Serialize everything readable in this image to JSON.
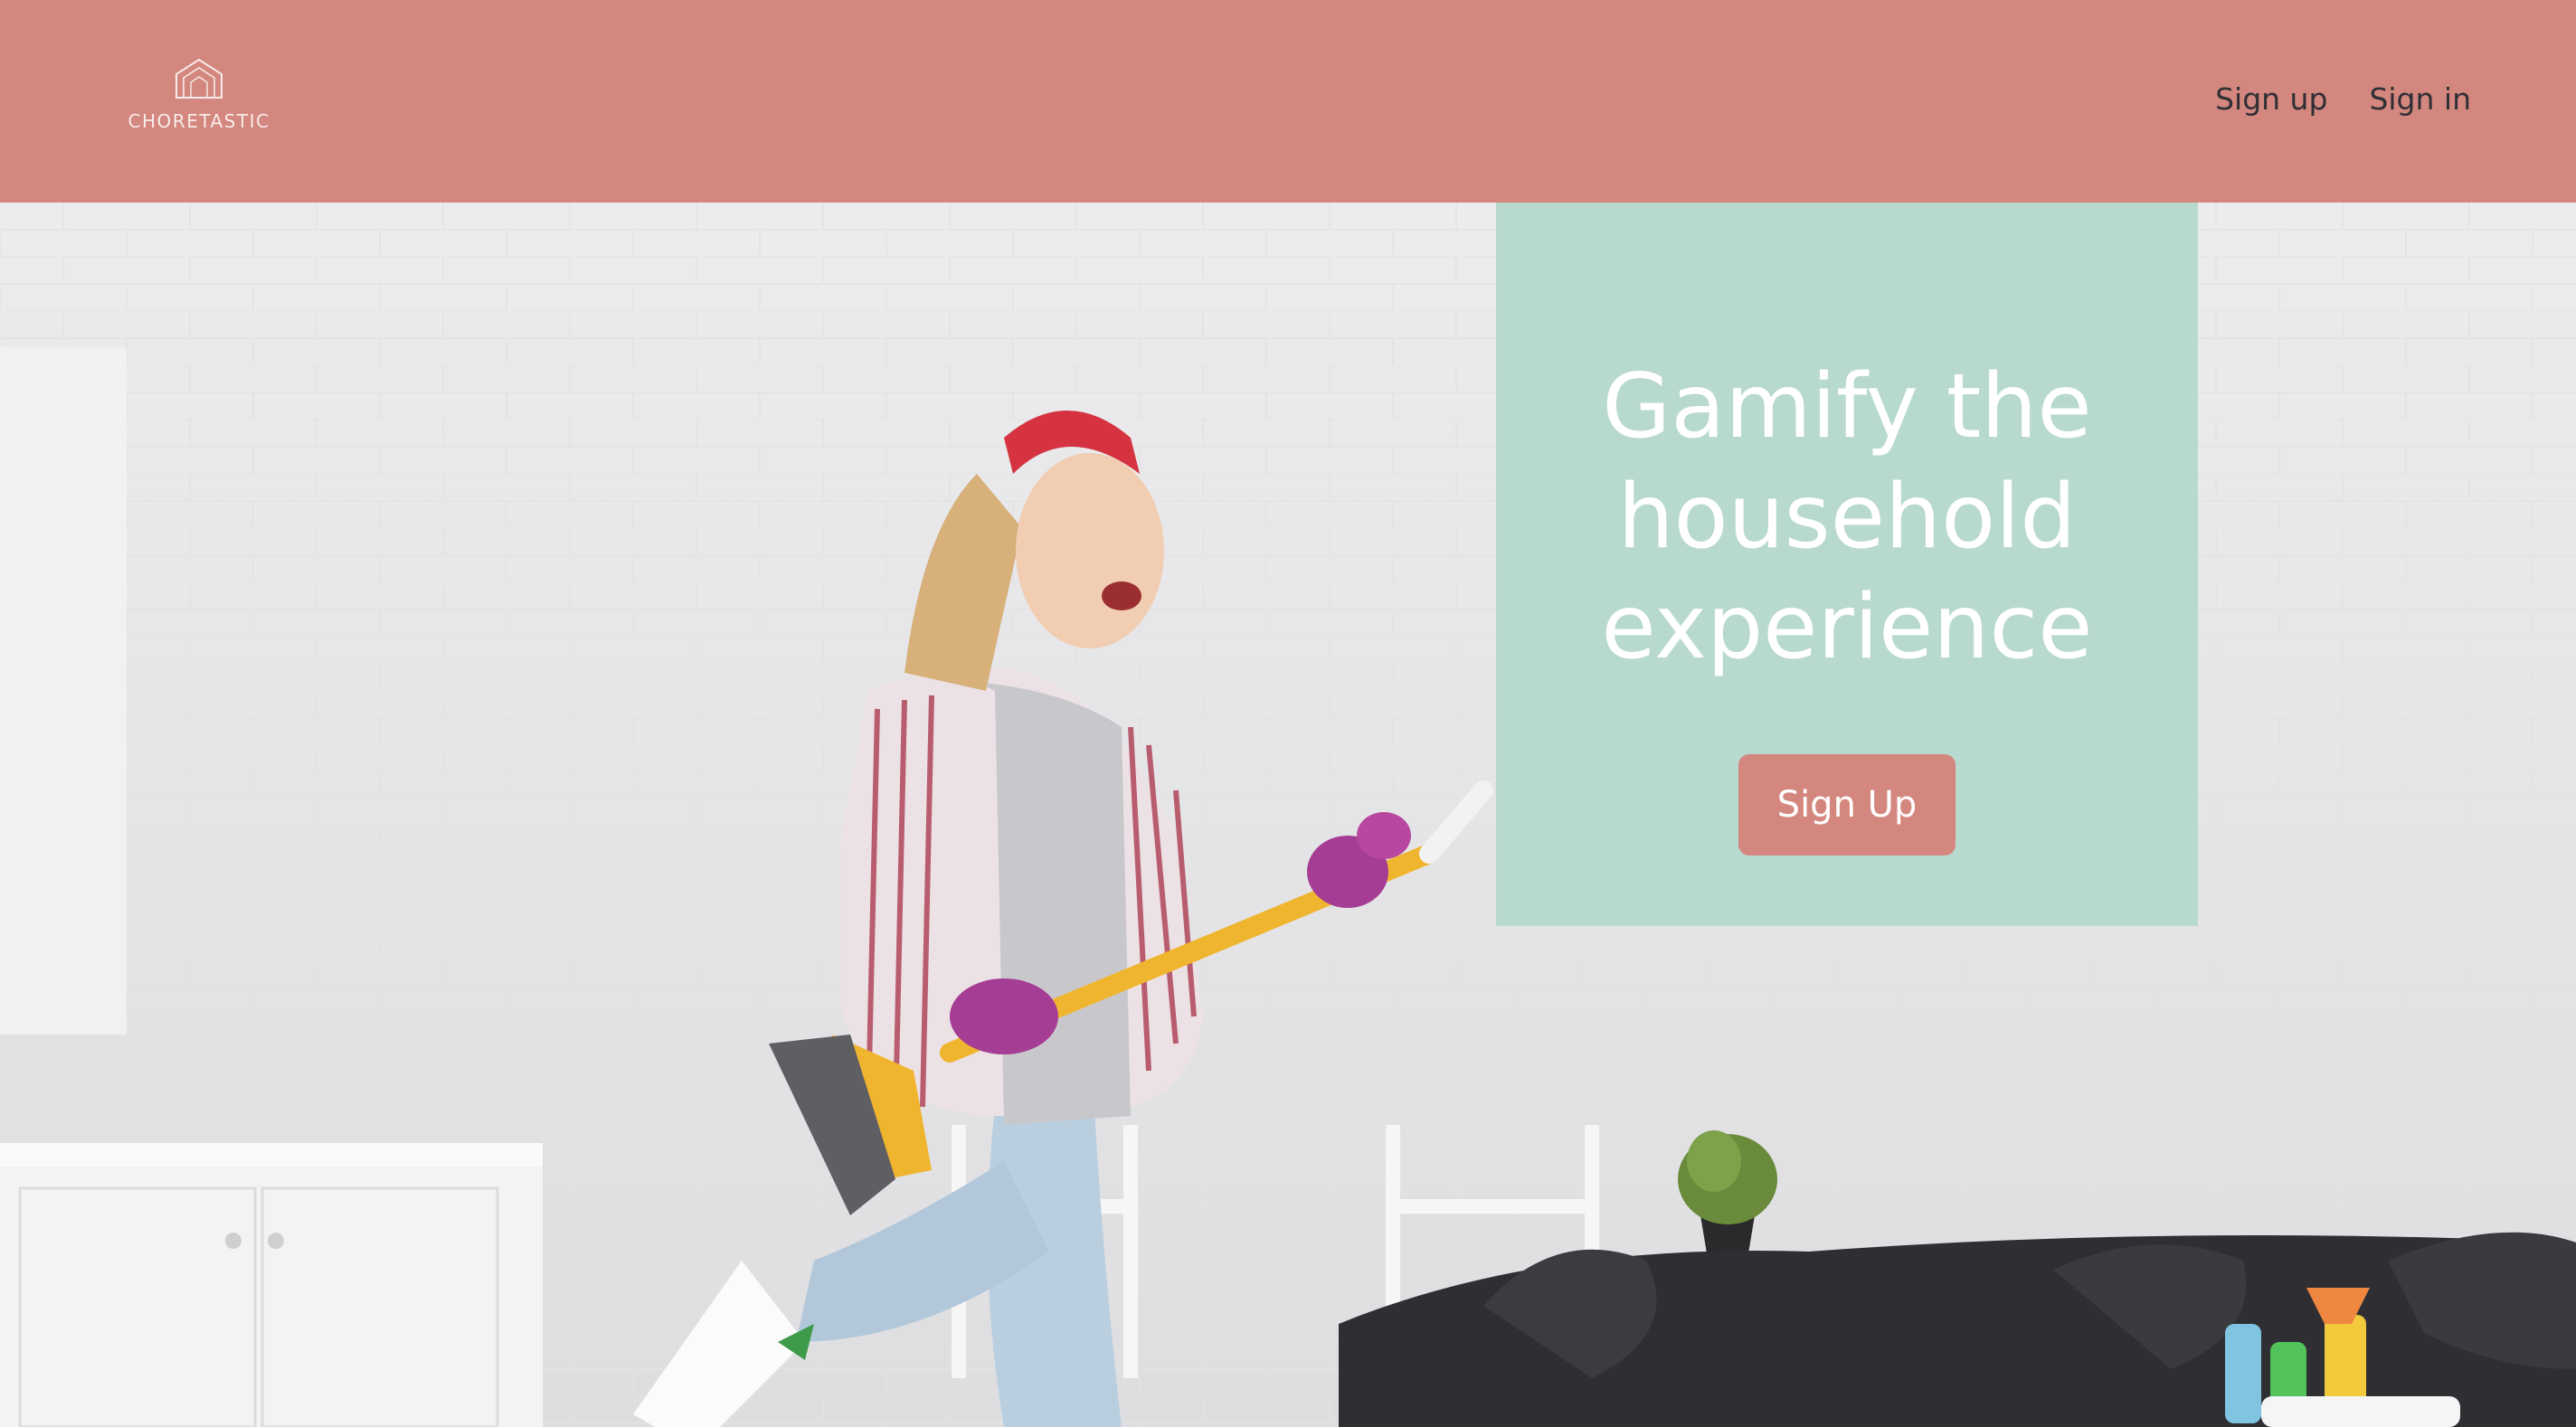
{
  "brand": {
    "name": "CHORETASTIC",
    "logo_icon": "house-roof-icon"
  },
  "nav": {
    "items": [
      {
        "label": "Sign up"
      },
      {
        "label": "Sign in"
      }
    ]
  },
  "hero": {
    "headline": "Gamify the\nhousehold\nexperience",
    "cta_label": "Sign Up",
    "image": "woman-with-broom-photo"
  },
  "colors": {
    "header_bg": "#d4877f",
    "card_bg": "#b8d9cd",
    "cta_bg": "#d4877f",
    "nav_text": "#2f2f35",
    "headline_text": "#ffffff"
  }
}
